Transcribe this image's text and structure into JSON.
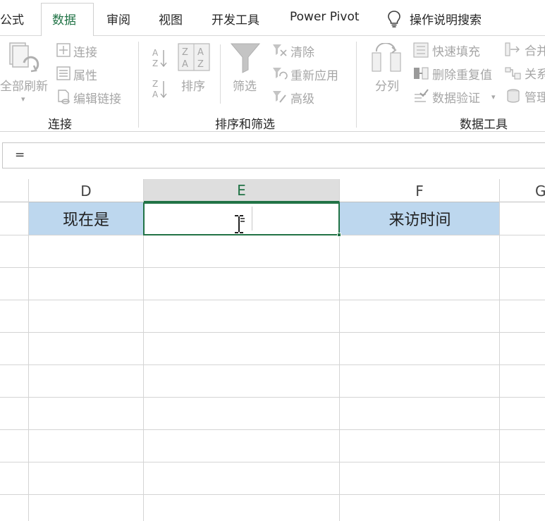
{
  "tabs": [
    {
      "label": "公式",
      "active": false
    },
    {
      "label": "数据",
      "active": true
    },
    {
      "label": "审阅",
      "active": false
    },
    {
      "label": "视图",
      "active": false
    },
    {
      "label": "开发工具",
      "active": false
    },
    {
      "label": "Power Pivot",
      "active": false
    }
  ],
  "tell_me": {
    "label": "操作说明搜索",
    "icon": "lightbulb-icon"
  },
  "ribbon": {
    "connections_group": {
      "refresh_all": "全部刷新",
      "connections": "连接",
      "properties": "属性",
      "edit_links": "编辑链接",
      "group_label": "连接"
    },
    "sort_filter_group": {
      "sort": "排序",
      "filter": "筛选",
      "clear": "清除",
      "reapply": "重新应用",
      "advanced": "高级",
      "group_label": "排序和筛选"
    },
    "data_tools_group": {
      "text_to_columns": "分列",
      "flash_fill": "快速填充",
      "remove_duplicates": "删除重复值",
      "data_validation": "数据验证",
      "consolidate": "合并",
      "relationships": "关系",
      "manage": "管理",
      "group_label": "数据工具"
    }
  },
  "formula_bar": {
    "value": "="
  },
  "columns": [
    {
      "label": "D",
      "selected": false
    },
    {
      "label": "E",
      "selected": true
    },
    {
      "label": "F",
      "selected": false
    },
    {
      "label": "G",
      "selected": false
    }
  ],
  "row1": {
    "d": "现在是",
    "e": "",
    "f": "来访时间"
  },
  "colors": {
    "accent": "#217346",
    "header_fill": "#bdd7ee"
  }
}
